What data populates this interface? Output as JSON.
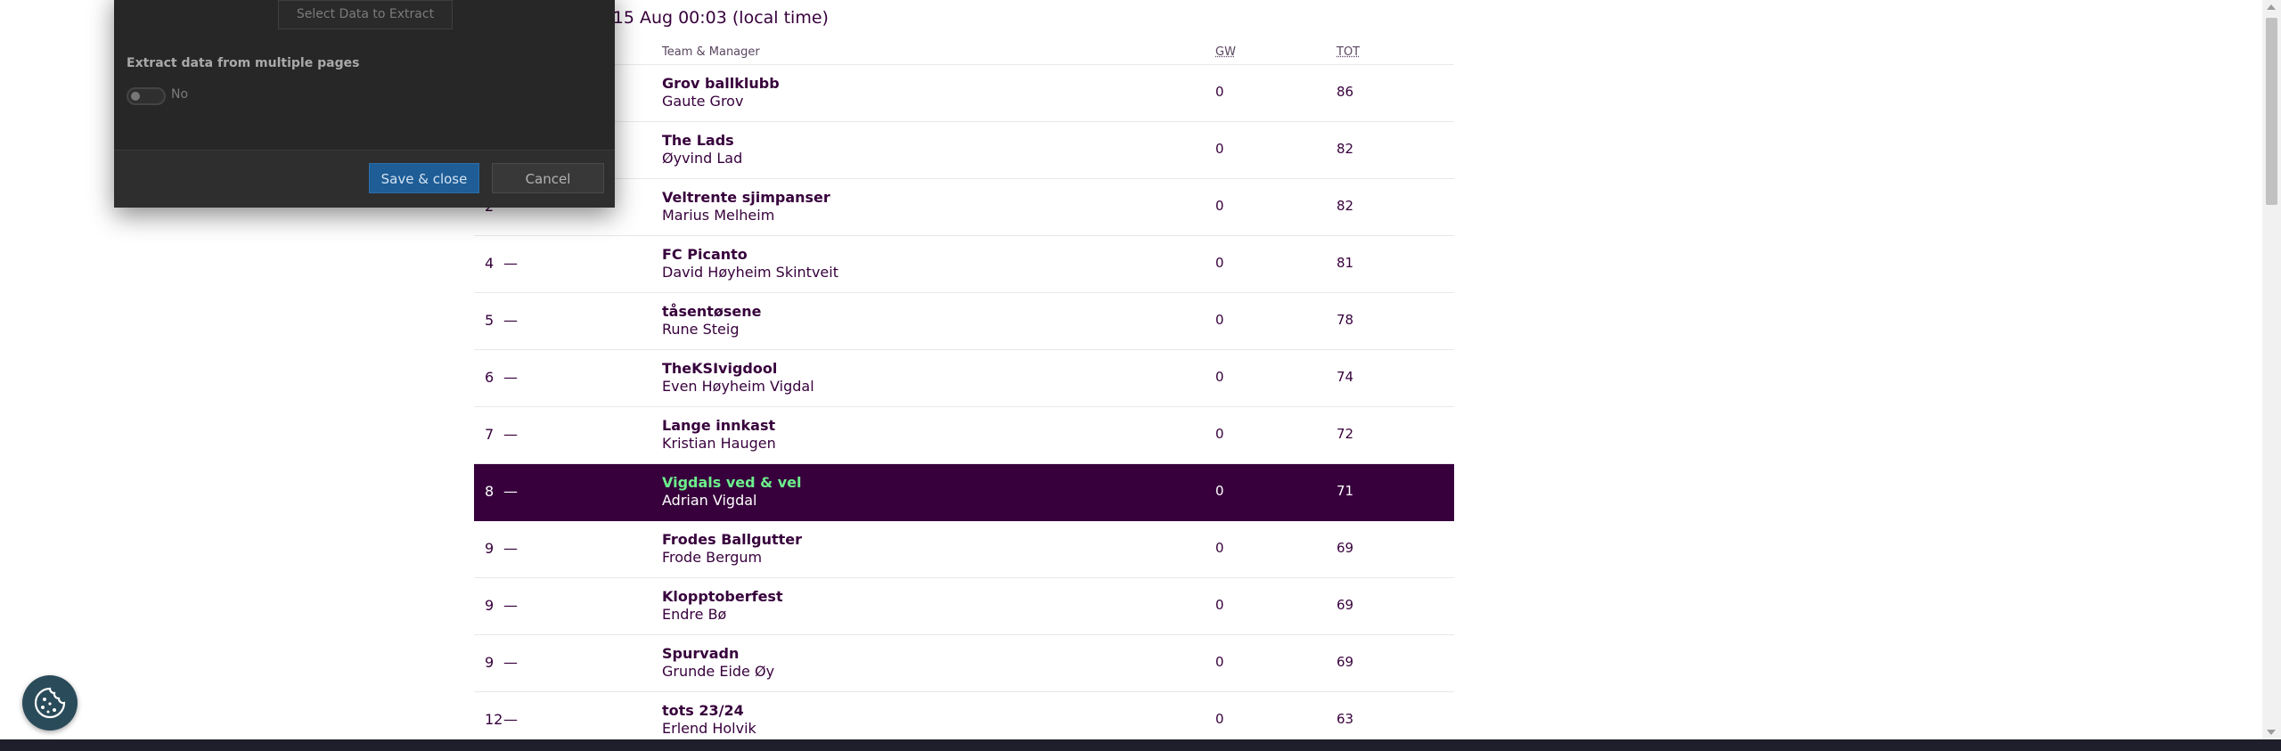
{
  "header": {
    "updated_text": "e 15 Aug 00:03 (local time)"
  },
  "table": {
    "columns": {
      "team": "Team & Manager",
      "gw": "GW",
      "tot": "TOT"
    },
    "rows": [
      {
        "rank": "",
        "move": "",
        "team": "Grov ballklubb",
        "manager": "Gaute Grov",
        "gw": "0",
        "tot": "86"
      },
      {
        "rank": "",
        "move": "",
        "team": "The Lads",
        "manager": "Øyvind Lad",
        "gw": "0",
        "tot": "82"
      },
      {
        "rank": "2",
        "move": "—",
        "team": "Veltrente sjimpanser",
        "manager": "Marius Melheim",
        "gw": "0",
        "tot": "82"
      },
      {
        "rank": "4",
        "move": "—",
        "team": "FC Picanto",
        "manager": "David Høyheim Skintveit",
        "gw": "0",
        "tot": "81"
      },
      {
        "rank": "5",
        "move": "—",
        "team": "tåsentøsene",
        "manager": "Rune Steig",
        "gw": "0",
        "tot": "78"
      },
      {
        "rank": "6",
        "move": "—",
        "team": "TheKSIvigdool",
        "manager": "Even Høyheim Vigdal",
        "gw": "0",
        "tot": "74"
      },
      {
        "rank": "7",
        "move": "—",
        "team": "Lange innkast",
        "manager": "Kristian Haugen",
        "gw": "0",
        "tot": "72"
      },
      {
        "rank": "8",
        "move": "—",
        "team": "Vigdals ved & vel",
        "manager": "Adrian Vigdal",
        "gw": "0",
        "tot": "71",
        "highlight": true
      },
      {
        "rank": "9",
        "move": "—",
        "team": "Frodes Ballgutter",
        "manager": "Frode Bergum",
        "gw": "0",
        "tot": "69"
      },
      {
        "rank": "9",
        "move": "—",
        "team": "Klopptoberfest",
        "manager": "Endre Bø",
        "gw": "0",
        "tot": "69"
      },
      {
        "rank": "9",
        "move": "—",
        "team": "Spurvadn",
        "manager": "Grunde Eide Øy",
        "gw": "0",
        "tot": "69"
      },
      {
        "rank": "12",
        "move": "—",
        "team": "tots 23/24",
        "manager": "Erlend Holvik",
        "gw": "0",
        "tot": "63"
      }
    ]
  },
  "modal": {
    "select_button": "Select Data to Extract",
    "multi_label": "Extract data from multiple pages",
    "toggle_text": "No",
    "save_label": "Save & close",
    "cancel_label": "Cancel"
  },
  "icons": {
    "cookie": "cookie-icon"
  },
  "colors": {
    "primary": "#37003c",
    "highlight_team": "#6cf08c",
    "save_button": "#1e5d96"
  }
}
